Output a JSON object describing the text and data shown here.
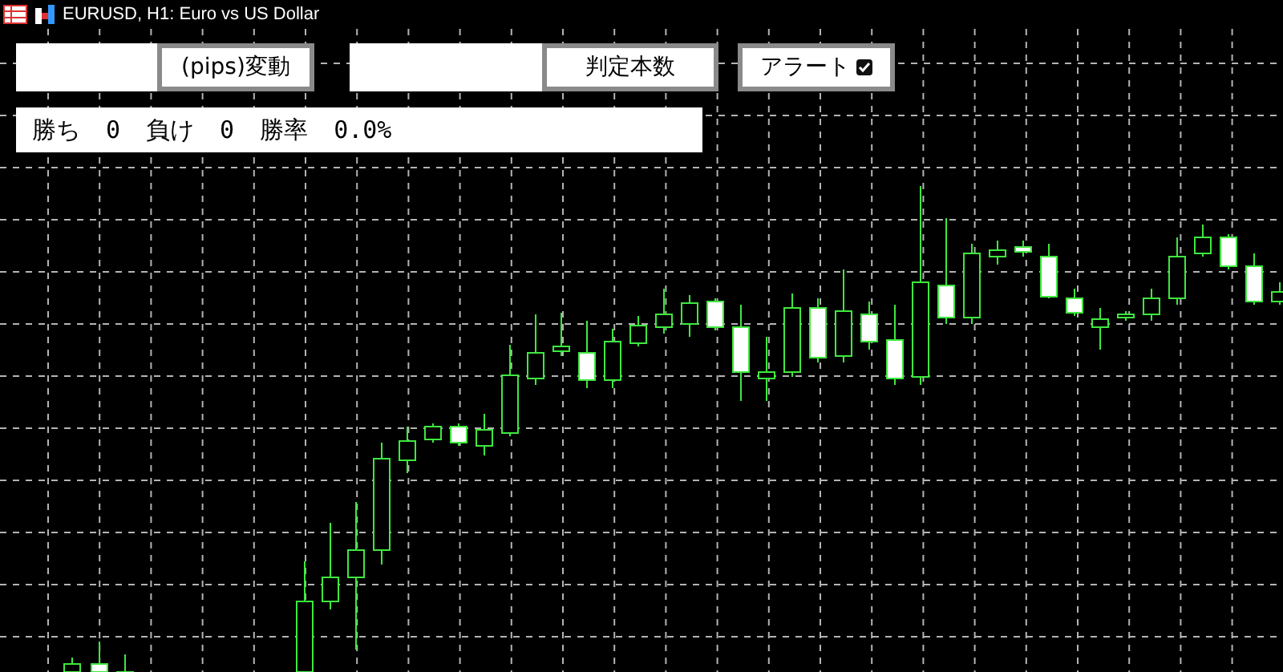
{
  "window": {
    "title": "EURUSD, H1: Euro vs US Dollar"
  },
  "controls": [
    {
      "kind": "field"
    },
    {
      "kind": "button",
      "label": "(pips)変動"
    },
    {
      "kind": "field"
    },
    {
      "kind": "button",
      "label": "判定本数"
    },
    {
      "kind": "toggle",
      "label": "アラート",
      "checked": true
    }
  ],
  "stats": [
    {
      "label": "勝ち",
      "value": "0"
    },
    {
      "label": "負け",
      "value": "0"
    },
    {
      "label": "勝率",
      "value": "0.0%"
    }
  ]
}
